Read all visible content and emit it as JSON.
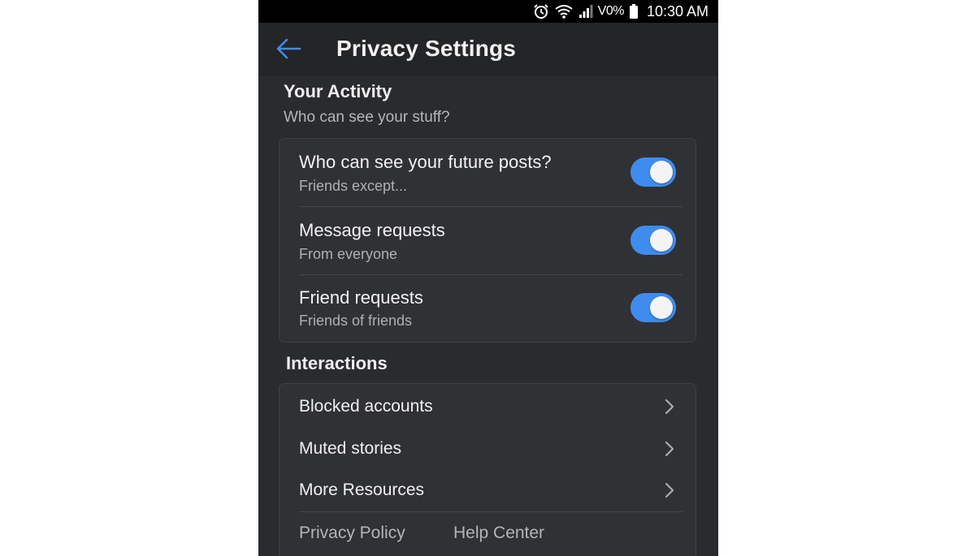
{
  "status_bar": {
    "network_label": "V0%",
    "time": "10:30 AM",
    "icons": [
      "alarm-icon",
      "wifi-icon",
      "signal-icon",
      "battery-icon"
    ]
  },
  "header": {
    "back_icon": "arrow-left-icon",
    "title": "Privacy Settings"
  },
  "colors": {
    "accent": "#3f8cf0",
    "background": "#2a2b2e",
    "card": "#303134"
  },
  "your_activity": {
    "title": "Your Activity",
    "subtitle": "Who can see your stuff?",
    "items": [
      {
        "label": "Who can see your future posts?",
        "value": "Friends except...",
        "enabled": true
      },
      {
        "label": "Message requests",
        "value": "From everyone",
        "enabled": true
      },
      {
        "label": "Friend requests",
        "value": "Friends of friends",
        "enabled": true
      }
    ]
  },
  "interactions": {
    "title": "Interactions",
    "items": [
      {
        "label": "Blocked accounts"
      },
      {
        "label": "Muted stories"
      },
      {
        "label": "More Resources"
      }
    ],
    "footer_links": [
      "Privacy Policy",
      "Help Center"
    ]
  }
}
